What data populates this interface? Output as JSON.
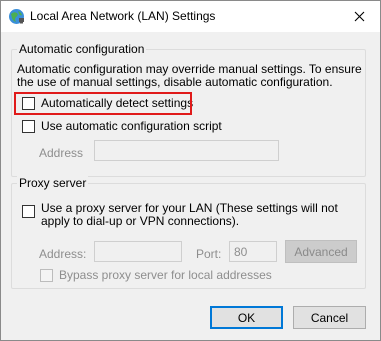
{
  "window": {
    "title": "Local Area Network (LAN) Settings",
    "close_glyph": "✕"
  },
  "auto_config": {
    "legend": "Automatic configuration",
    "description": "Automatic configuration may override manual settings. To ensure the use of manual settings, disable automatic configuration.",
    "detect_label": "Automatically detect settings",
    "detect_checked": false,
    "script_label": "Use automatic configuration script",
    "script_checked": false,
    "address_label": "Address",
    "address_value": ""
  },
  "proxy": {
    "legend": "Proxy server",
    "use_proxy_label": "Use a proxy server for your LAN (These settings will not apply to dial-up or VPN connections).",
    "use_proxy_checked": false,
    "address_label": "Address:",
    "address_value": "",
    "port_label": "Port:",
    "port_value": "80",
    "advanced_label": "Advanced",
    "bypass_label": "Bypass proxy server for local addresses",
    "bypass_checked": false
  },
  "buttons": {
    "ok": "OK",
    "cancel": "Cancel"
  },
  "colors": {
    "highlight": "#e01a1a",
    "default_button_border": "#0078d7"
  },
  "icons": {
    "app": "network-globe-icon",
    "close": "close-icon"
  }
}
